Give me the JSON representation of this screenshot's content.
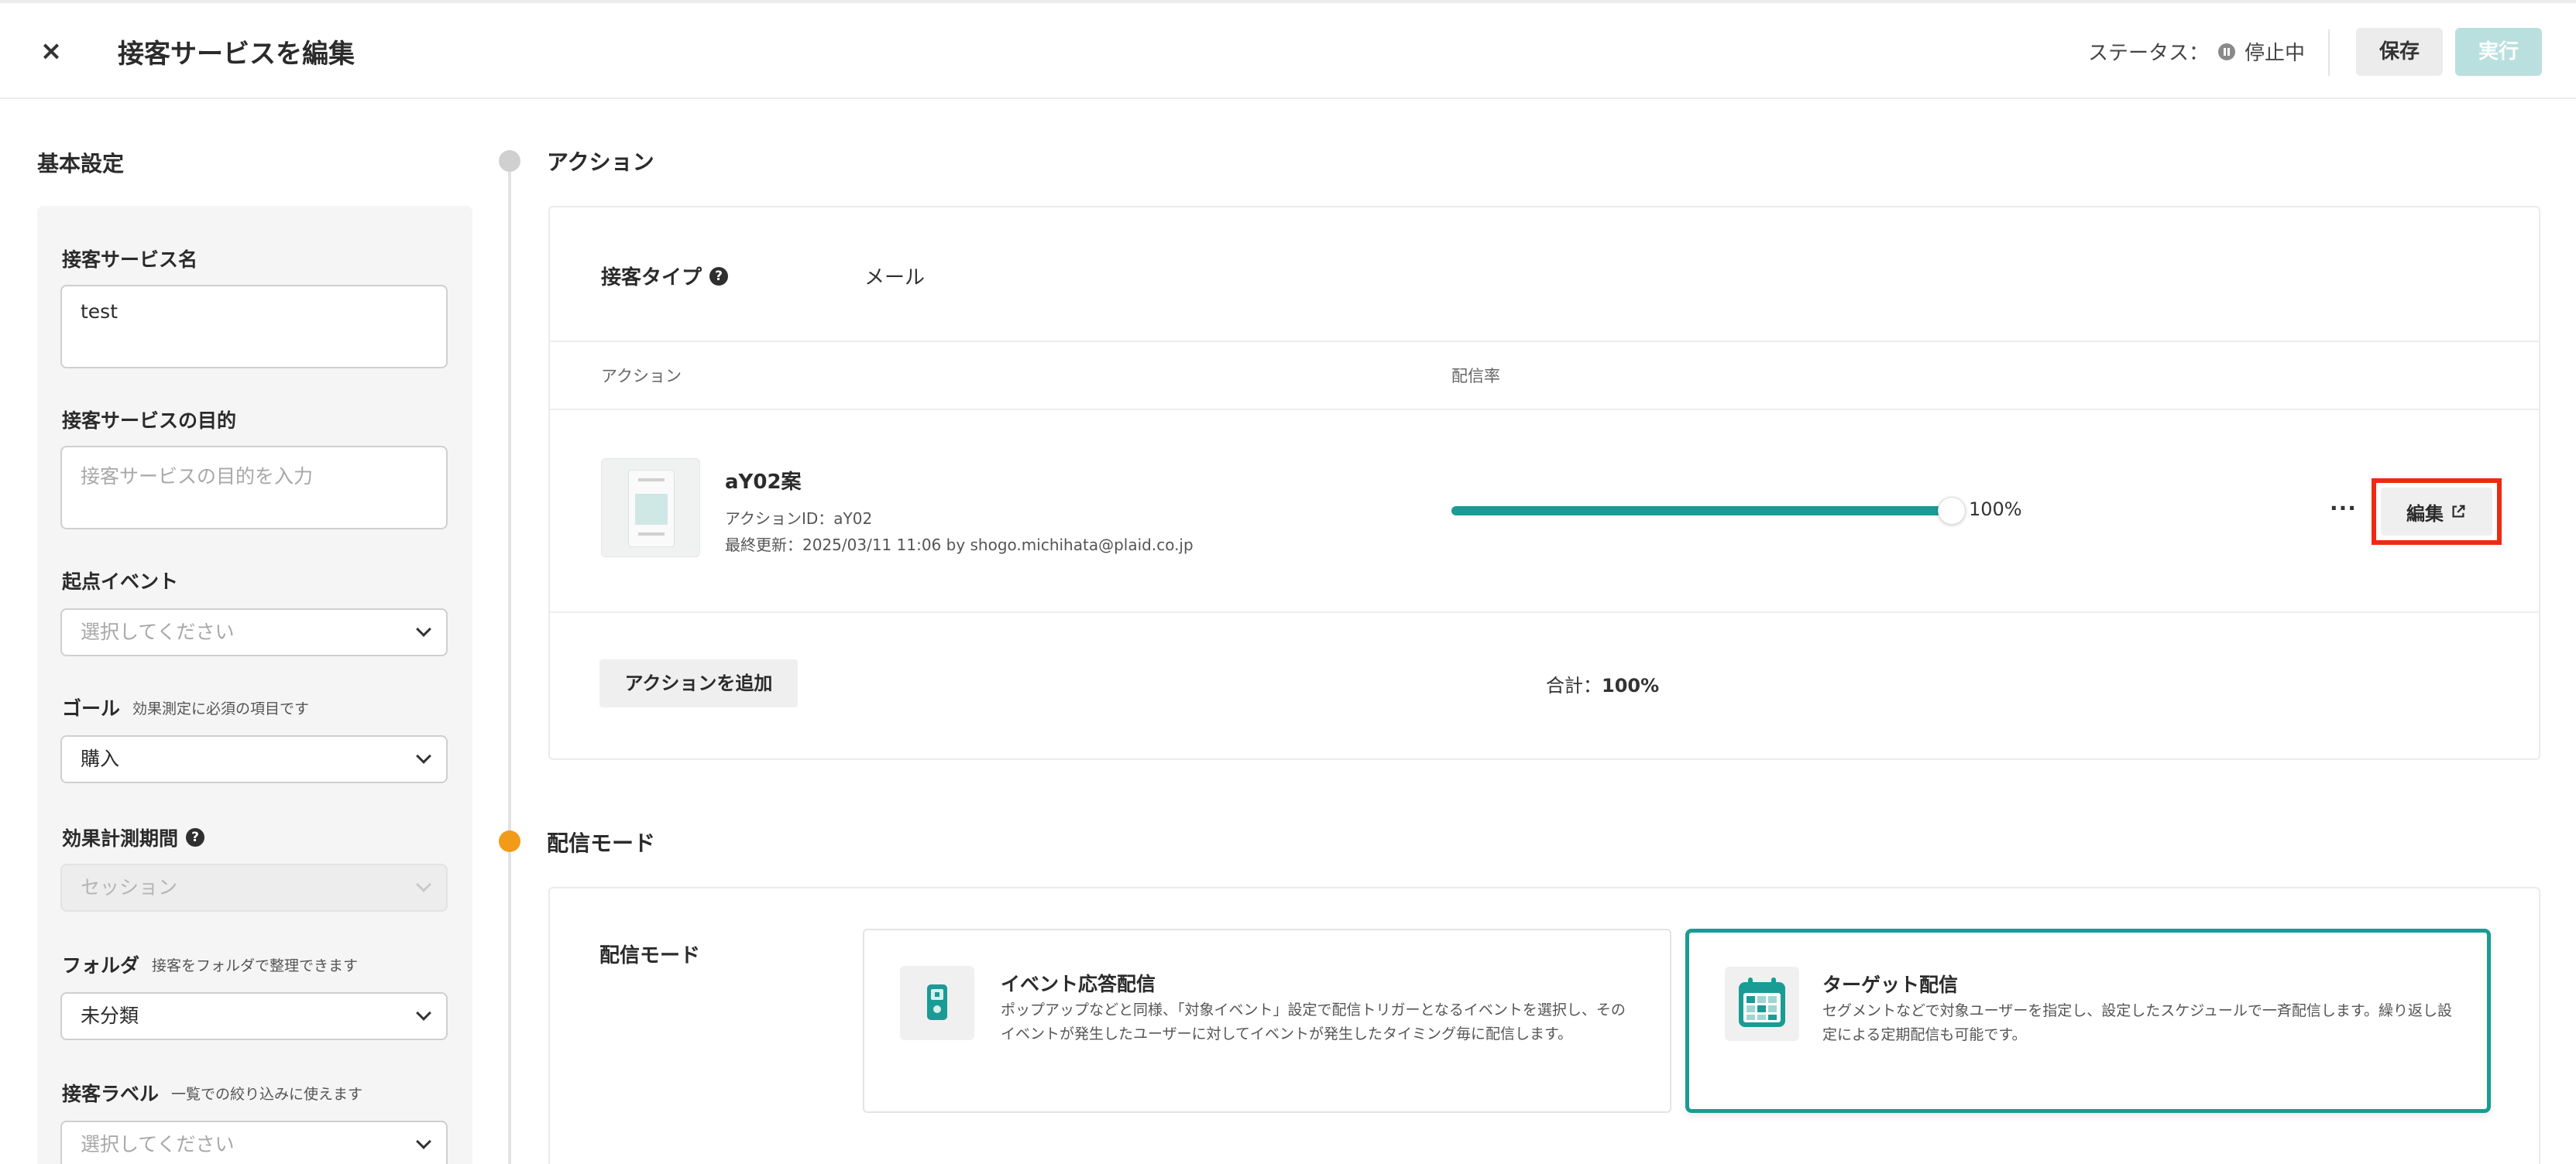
{
  "header": {
    "close_label": "×",
    "title": "接客サービスを編集",
    "status_label": "ステータス：",
    "status_value": "停止中",
    "save_label": "保存",
    "run_label": "実行"
  },
  "basic": {
    "section_title": "基本設定",
    "name": {
      "label": "接客サービス名",
      "value": "test"
    },
    "purpose": {
      "label": "接客サービスの目的",
      "placeholder": "接客サービスの目的を入力"
    },
    "start_event": {
      "label": "起点イベント",
      "placeholder": "選択してください"
    },
    "goal": {
      "label": "ゴール",
      "hint": "効果測定に必須の項目です",
      "value": "購入"
    },
    "measure_period": {
      "label": "効果計測期間",
      "help": "?",
      "value": "セッション"
    },
    "folder": {
      "label": "フォルダ",
      "hint": "接客をフォルダで整理できます",
      "value": "未分類"
    },
    "label_field": {
      "label": "接客ラベル",
      "hint": "一覧での絞り込みに使えます",
      "placeholder": "選択してください"
    }
  },
  "action_section": {
    "title": "アクション",
    "type_label": "接客タイプ",
    "type_help": "?",
    "type_value": "メール",
    "col_action": "アクション",
    "col_rate": "配信率",
    "item": {
      "name": "aY02案",
      "id_text": "アクションID：aY02",
      "updated_text": "最終更新：2025/03/11 11:06 by shogo.michihata@plaid.co.jp",
      "rate_percent": 100,
      "rate_text": "100%",
      "more_label": "···",
      "edit_label": "編集"
    },
    "add_label": "アクションを追加",
    "total_label": "合計：",
    "total_value": "100%"
  },
  "mode_section": {
    "title": "配信モード",
    "label": "配信モード",
    "options": [
      {
        "title": "イベント応答配信",
        "desc": "ポップアップなどと同様、「対象イベント」設定で配信トリガーとなるイベントを選択し、そのイベントが発生したユーザーに対してイベントが発生したタイミング毎に配信します。",
        "selected": false,
        "icon": "event-trigger-icon"
      },
      {
        "title": "ターゲット配信",
        "desc": "セグメントなどで対象ユーザーを指定し、設定したスケジュールで一斉配信します。繰り返し設定による定期配信も可能です。",
        "selected": true,
        "icon": "calendar-icon"
      }
    ]
  },
  "colors": {
    "accent": "#1a9b95",
    "highlight": "#ee2a12",
    "timeline_active": "#f29b18",
    "run_disabled": "#b9e0de"
  }
}
